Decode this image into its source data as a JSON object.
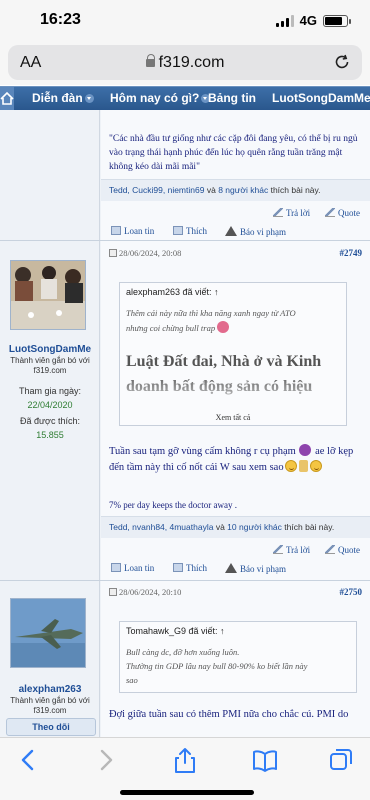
{
  "status": {
    "time": "16:23",
    "network": "4G"
  },
  "browser": {
    "text_size": "AA",
    "url": "f319.com"
  },
  "nav": {
    "forum": "Diễn đàn",
    "today": "Hôm nay có gì?",
    "news": "Bảng tin",
    "user": "LuotSongDamMe"
  },
  "posts": [
    {
      "quote_text": "\"Các nhà đầu tư giống như các cặp đôi đang yêu, có thể bị ru ngủ vào trạng thái hạnh phúc đến lúc họ quên rằng tuần trăng mật không kéo dài mãi mãi\"",
      "likes": {
        "names": "Tedd, Cucki99, niemtin69",
        "conj": "và",
        "others": "8 người khác",
        "suffix": "thích bài này."
      },
      "actions": {
        "reply": "Trả lời",
        "quote": "Quote",
        "spread": "Loan tin",
        "like": "Thích",
        "report": "Báo vi phạm"
      }
    },
    {
      "date": "28/06/2024, 20:08",
      "number": "#2749",
      "user": {
        "name": "LuotSongDamMe",
        "title": "Thành viên gắn bó với f319.com",
        "joined_label": "Tham gia ngày:",
        "joined": "22/04/2020",
        "likes_label": "Đã được thích:",
        "likes": "15.855"
      },
      "quote": {
        "author": "alexpham263 đã viết: ↑",
        "line1": "Thêm cái này nữa thì kha năng xanh ngay từ ATO",
        "line2": "nhưng coi chừng bull trap",
        "big": "Luật Đất đai, Nhà ở và Kinh doanh bất động sản có hiệu",
        "see_all": "Xem tất cả"
      },
      "text": "Tuần sau tạm gỡ vùng cấm không r cụ phạm",
      "text2": "ae lỡ kẹp đến tầm này thì cố nốt cái W sau xem sao",
      "signature": "7% per day keeps the doctor away .",
      "likes": {
        "names": "Tedd, nvanh84, 4muathayla",
        "conj": "và",
        "others": "10 người khác",
        "suffix": "thích bài này."
      },
      "actions": {
        "reply": "Trả lời",
        "quote": "Quote",
        "spread": "Loan tin",
        "like": "Thích",
        "report": "Báo vi phạm"
      }
    },
    {
      "date": "28/06/2024, 20:10",
      "number": "#2750",
      "user": {
        "name": "alexpham263",
        "title": "Thành viên gắn bó với f319.com",
        "follow": "Theo dõi"
      },
      "quote": {
        "author": "Tomahawk_G9 đã viết: ↑",
        "line1": "Bull càng dc, đỡ hơn xuống luôn.",
        "line2": "Thường tin GDP lâu nay bull 80-90% ko biết lần này",
        "line3": "sao"
      },
      "text": "Đợi giữa tuần sau có thêm PMI nữa cho chắc cú. PMI do"
    }
  ],
  "colors": {
    "nav": "#2f5f97",
    "link": "#1f4e96",
    "post_text": "#1a237e",
    "stat": "#2e7d32"
  }
}
